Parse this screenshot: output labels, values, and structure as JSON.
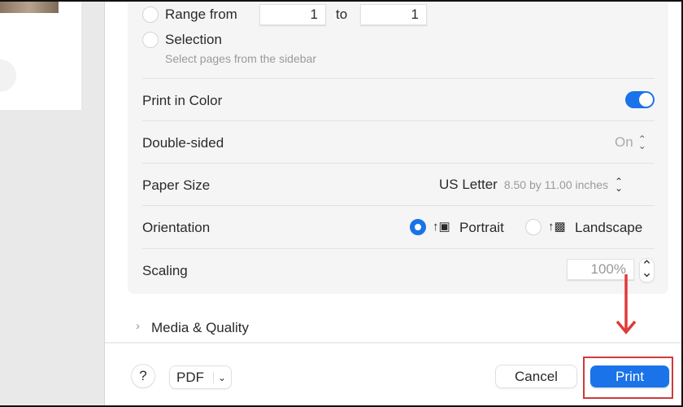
{
  "pages": {
    "range_label": "Range from",
    "range_from": "1",
    "to_label": "to",
    "range_to": "1",
    "selection_label": "Selection",
    "selection_hint": "Select pages from the sidebar"
  },
  "settings": {
    "print_in_color": {
      "label": "Print in Color",
      "enabled": true
    },
    "double_sided": {
      "label": "Double-sided",
      "value": "On"
    },
    "paper_size": {
      "label": "Paper Size",
      "value": "US Letter",
      "detail": "8.50 by 11.00 inches"
    },
    "orientation": {
      "label": "Orientation",
      "options": [
        "Portrait",
        "Landscape"
      ],
      "selected": "Portrait"
    },
    "scaling": {
      "label": "Scaling",
      "value": "100%"
    }
  },
  "media_quality": {
    "label": "Media & Quality"
  },
  "footer": {
    "help": "?",
    "pdf": "PDF",
    "cancel": "Cancel",
    "print": "Print"
  },
  "colors": {
    "accent": "#1a73e8",
    "annotation": "#e03a3a"
  }
}
